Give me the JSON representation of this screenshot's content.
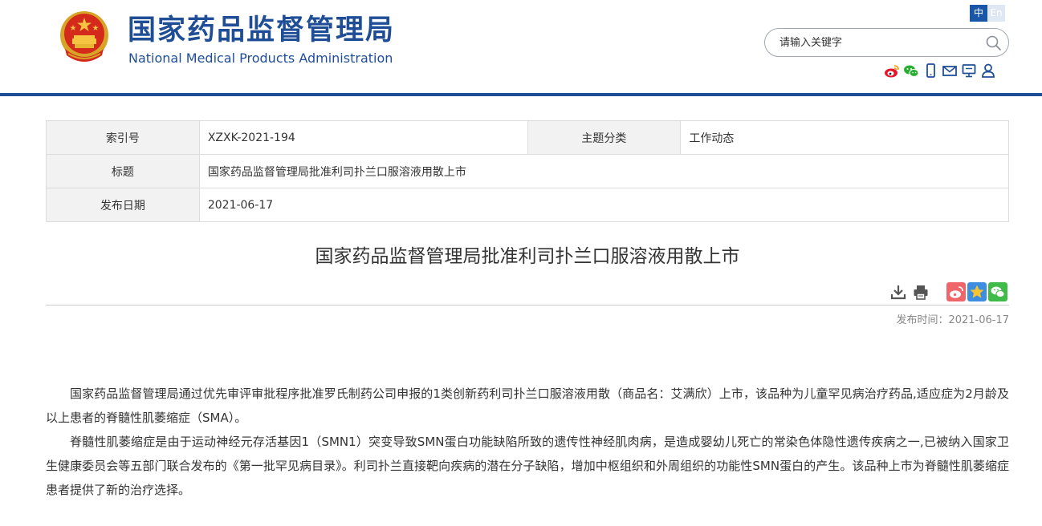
{
  "header": {
    "title_cn": "国家药品监督管理局",
    "title_en": "National Medical Products Administration",
    "lang_zh": "中",
    "lang_en": "En",
    "search_placeholder": "请输入关键字",
    "social_icons": [
      "weibo-icon",
      "wechat-icon",
      "mobile-icon",
      "mail-icon",
      "monitor-icon",
      "user-icon"
    ],
    "brand_color": "#1f4e97"
  },
  "meta": {
    "index_label": "索引号",
    "index_value": "XZXK-2021-194",
    "category_label": "主题分类",
    "category_value": "工作动态",
    "title_label": "标题",
    "title_value": "国家药品监督管理局批准利司扑兰口服溶液用散上市",
    "date_label": "发布日期",
    "date_value": "2021-06-17"
  },
  "article": {
    "title": "国家药品监督管理局批准利司扑兰口服溶液用散上市",
    "publish_time": "发布时间：2021-06-17",
    "tool_icons": [
      "download-icon",
      "print-icon",
      "weibo-share-icon",
      "favorite-icon",
      "wechat-share-icon"
    ],
    "paragraphs": [
      "国家药品监督管理局通过优先审评审批程序批准罗氏制药公司申报的1类创新药利司扑兰口服溶液用散（商品名：艾满欣）上市，该品种为儿童罕见病治疗药品,适应症为2月龄及以上患者的脊髓性肌萎缩症（SMA）。",
      "脊髓性肌萎缩症是由于运动神经元存活基因1（SMN1）突变导致SMN蛋白功能缺陷所致的遗传性神经肌肉病，是造成婴幼儿死亡的常染色体隐性遗传疾病之一,已被纳入国家卫生健康委员会等五部门联合发布的《第一批罕见病目录》。利司扑兰直接靶向疾病的潜在分子缺陷，增加中枢组织和外周组织的功能性SMN蛋白的产生。该品种上市为脊髓性肌萎缩症患者提供了新的治疗选择。"
    ]
  }
}
